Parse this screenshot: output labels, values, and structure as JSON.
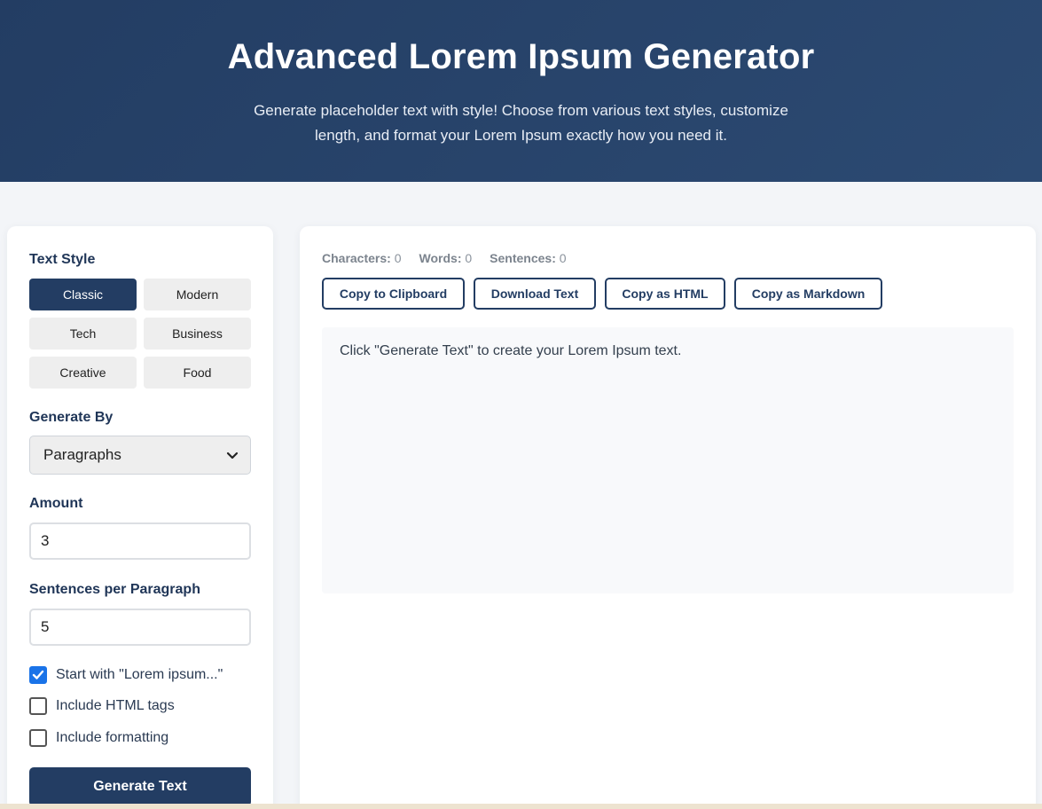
{
  "header": {
    "title": "Advanced Lorem Ipsum Generator",
    "subtitle": "Generate placeholder text with style! Choose from various text styles, customize length, and format your Lorem Ipsum exactly how you need it."
  },
  "sidebar": {
    "text_style_label": "Text Style",
    "styles": [
      "Classic",
      "Modern",
      "Tech",
      "Business",
      "Creative",
      "Food"
    ],
    "active_style": "Classic",
    "generate_by_label": "Generate By",
    "generate_by_value": "Paragraphs",
    "amount_label": "Amount",
    "amount_value": "3",
    "sentences_label": "Sentences per Paragraph",
    "sentences_value": "5",
    "options": [
      {
        "label": "Start with \"Lorem ipsum...\"",
        "checked": true
      },
      {
        "label": "Include HTML tags",
        "checked": false
      },
      {
        "label": "Include formatting",
        "checked": false
      }
    ],
    "generate_button": "Generate Text"
  },
  "content": {
    "stats": {
      "characters_label": "Characters:",
      "characters_value": "0",
      "words_label": "Words:",
      "words_value": "0",
      "sentences_label": "Sentences:",
      "sentences_value": "0"
    },
    "actions": [
      "Copy to Clipboard",
      "Download Text",
      "Copy as HTML",
      "Copy as Markdown"
    ],
    "output_placeholder": "Click \"Generate Text\" to create your Lorem Ipsum text."
  },
  "colors": {
    "primary": "#233d63",
    "checkbox_accent": "#1a73e8",
    "page_background": "#f3f5f8"
  }
}
